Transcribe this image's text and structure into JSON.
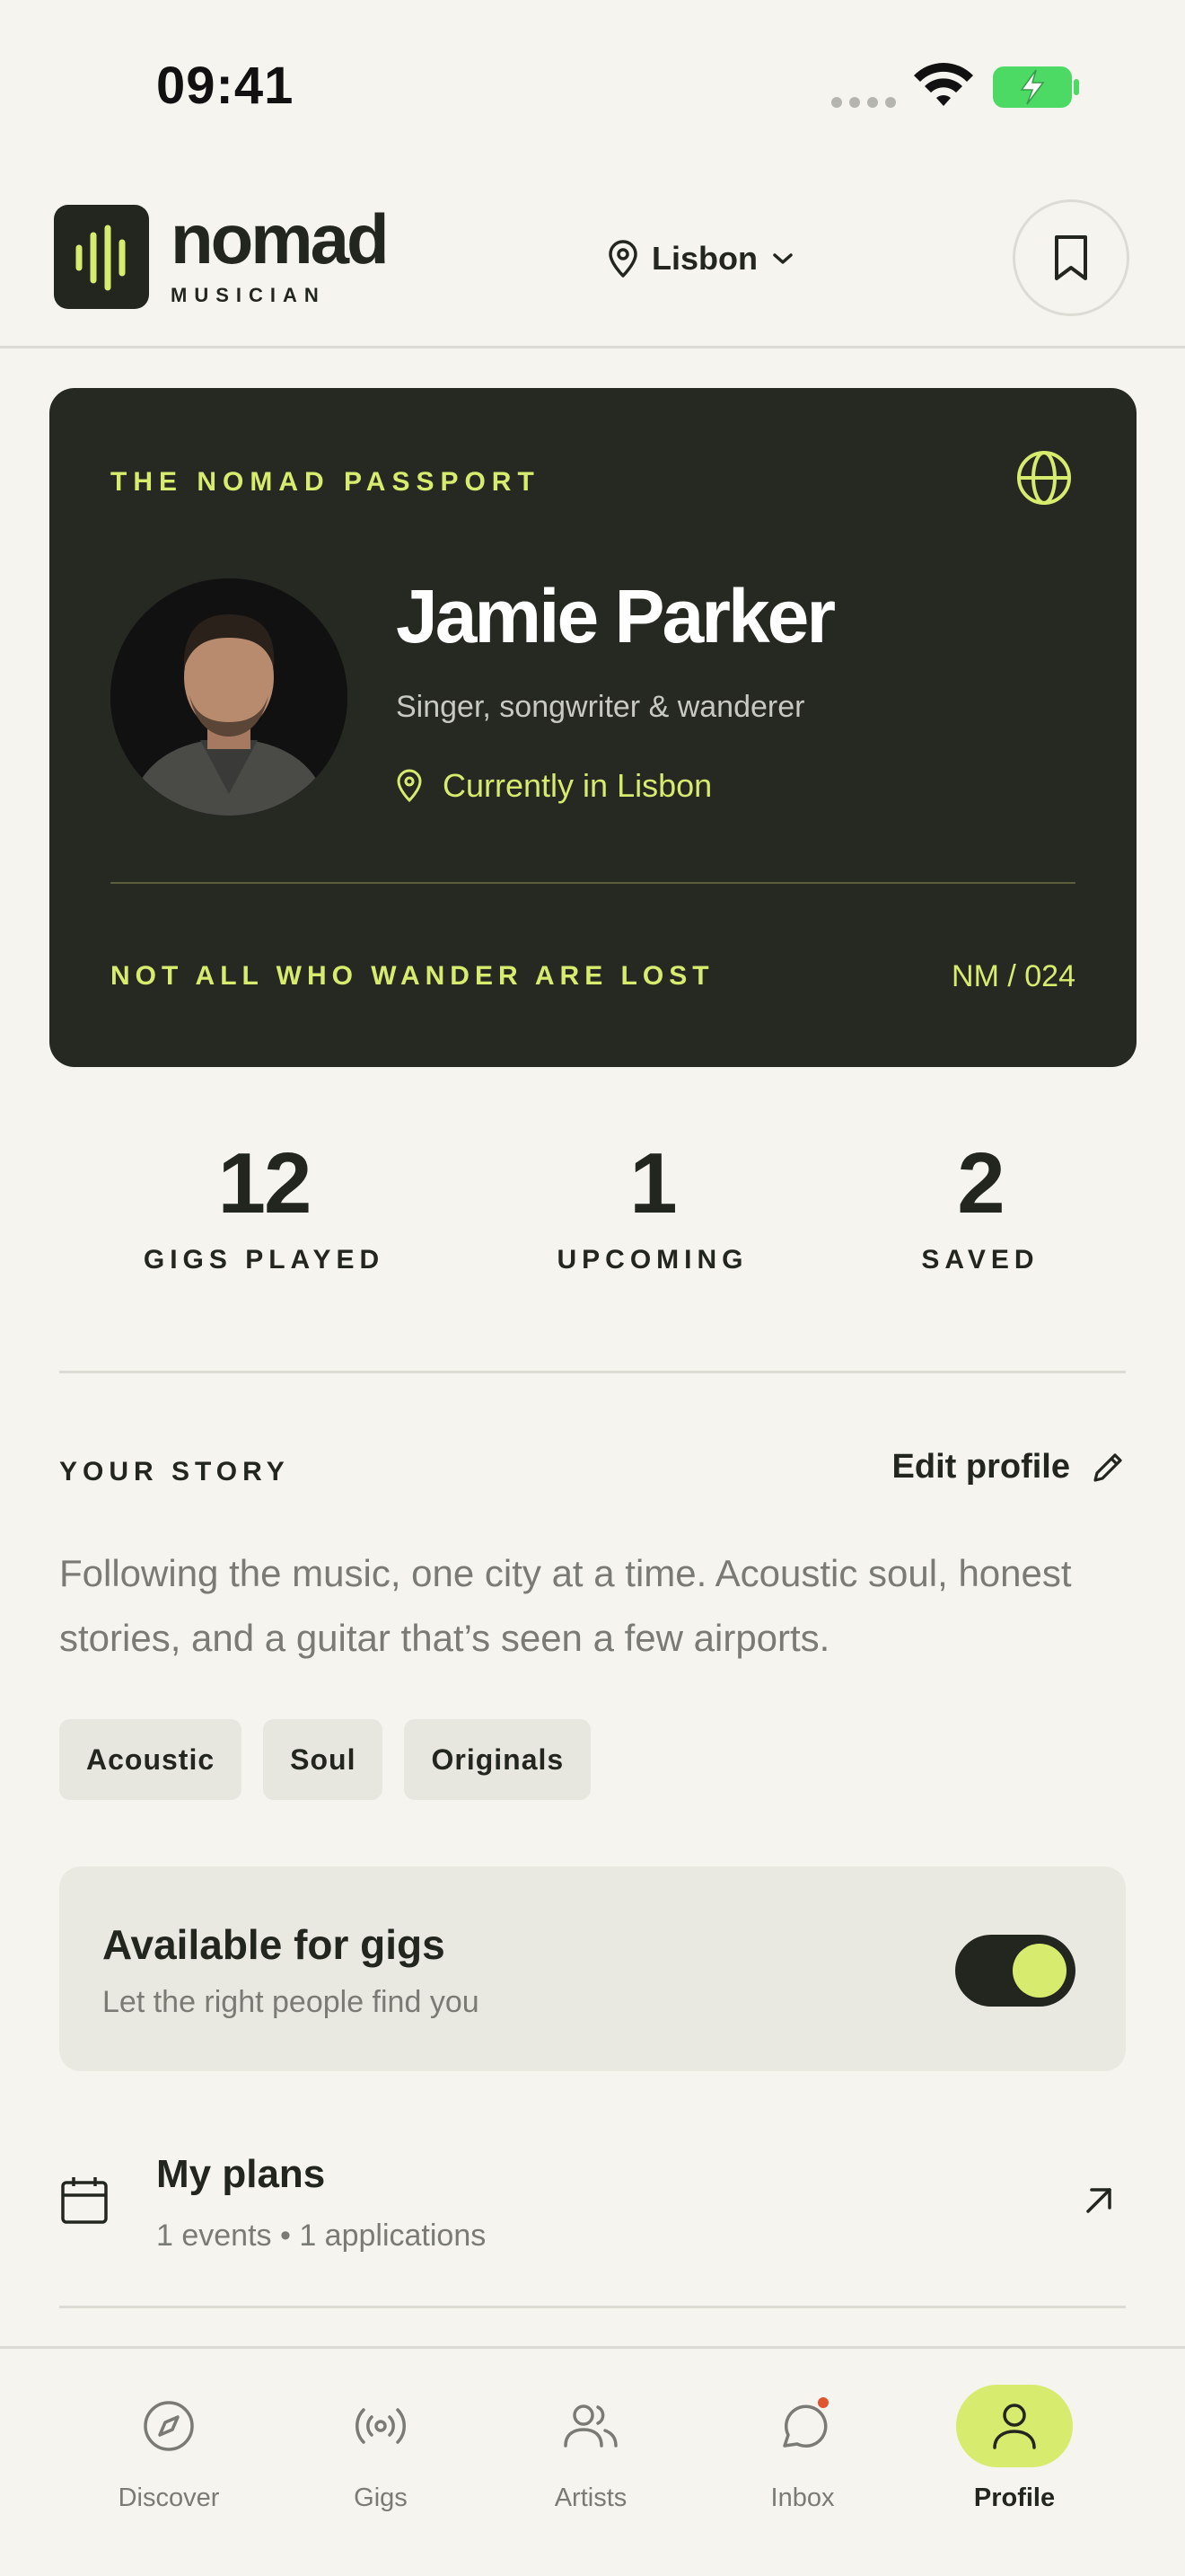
{
  "status_bar": {
    "time": "09:41"
  },
  "header": {
    "logo_text": "nomad",
    "logo_subtitle": "MUSICIAN",
    "location": "Lisbon",
    "icons": {
      "location": "map-pin-icon",
      "dropdown": "chevron-down-icon",
      "bookmark": "bookmark-icon"
    }
  },
  "passport": {
    "title": "THE NOMAD PASSPORT",
    "name": "Jamie Parker",
    "bio": "Singer, songwriter & wanderer",
    "current_location": "Currently in Lisbon",
    "motto": "NOT ALL WHO WANDER ARE LOST",
    "number": "NM / 024",
    "icons": {
      "globe": "globe-icon",
      "location": "map-pin-icon"
    }
  },
  "stats": [
    {
      "value": "12",
      "label": "GIGS PLAYED"
    },
    {
      "value": "1",
      "label": "UPCOMING"
    },
    {
      "value": "2",
      "label": "SAVED"
    }
  ],
  "story": {
    "heading": "YOUR STORY",
    "edit_label": "Edit profile",
    "text": "Following the music, one city at a time. Acoustic soul, honest stories, and a guitar that’s seen a few airports.",
    "tags": [
      "Acoustic",
      "Soul",
      "Originals"
    ]
  },
  "availability": {
    "title": "Available for gigs",
    "subtitle": "Let the right people find you",
    "enabled": true
  },
  "plans": {
    "title": "My plans",
    "subtitle": "1 events • 1 applications"
  },
  "nav": {
    "items": [
      {
        "label": "Discover",
        "icon": "compass-icon",
        "active": false
      },
      {
        "label": "Gigs",
        "icon": "broadcast-icon",
        "active": false
      },
      {
        "label": "Artists",
        "icon": "users-icon",
        "active": false
      },
      {
        "label": "Inbox",
        "icon": "message-icon",
        "active": false,
        "badge": true
      },
      {
        "label": "Profile",
        "icon": "user-icon",
        "active": true
      }
    ]
  },
  "colors": {
    "accent": "#d7ec6f",
    "dark": "#23261f",
    "background": "#f5f4ef",
    "badge": "#e0542f"
  }
}
